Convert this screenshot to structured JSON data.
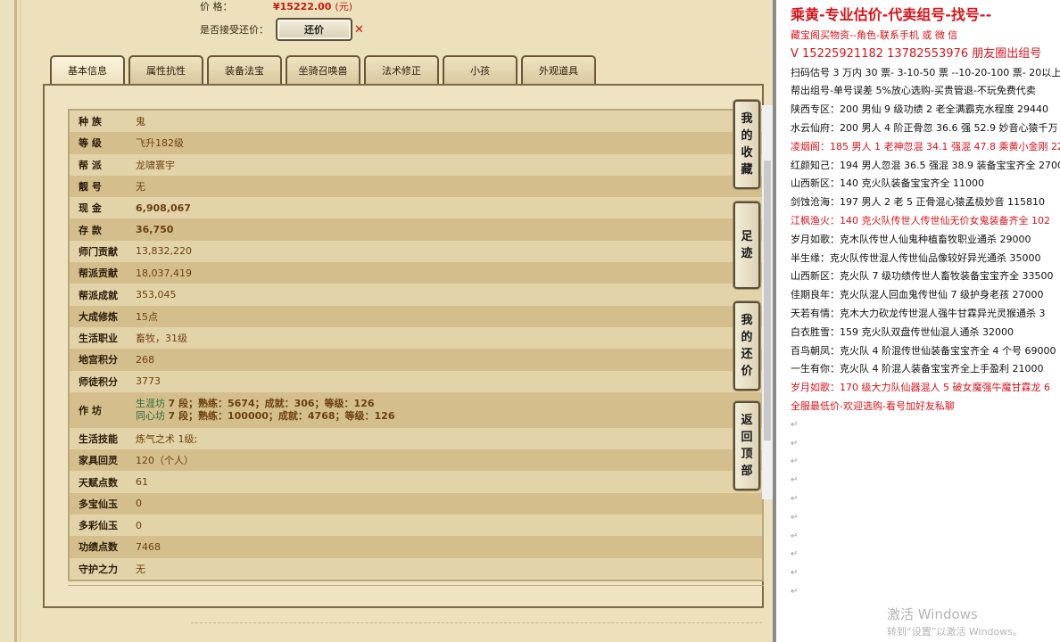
{
  "top": {
    "price_label": "价      格：",
    "price_value": "¥15222.00",
    "price_unit": "(元)",
    "bargain_label": "是否接受还价：",
    "bargain_button": "还价"
  },
  "tabs": [
    "基本信息",
    "属性抗性",
    "装备法宝",
    "坐骑召唤兽",
    "法术修正",
    "小孩",
    "外观道具"
  ],
  "info_rows": [
    {
      "k": "种    族",
      "v": "鬼",
      "style": "green"
    },
    {
      "k": "等    级",
      "v": "飞升182级",
      "style": "green"
    },
    {
      "k": "帮    派",
      "v": "龙啸寰宇",
      "style": "green"
    },
    {
      "k": "靓    号",
      "v": "无",
      "style": "gold"
    },
    {
      "k": "现    金",
      "v": "6,908,067",
      "style": "yellow"
    },
    {
      "k": "存    款",
      "v": "36,750",
      "style": "brightgreen"
    },
    {
      "k": "师门贡献",
      "v": "13,832,220",
      "style": "gold"
    },
    {
      "k": "帮派贡献",
      "v": "18,037,419",
      "style": "gold"
    },
    {
      "k": "帮派成就",
      "v": "353,045",
      "style": "gold"
    },
    {
      "k": "大成修炼",
      "v": "15点",
      "style": "gold"
    },
    {
      "k": "生活职业",
      "v": "畜牧，31级",
      "style": "gold"
    },
    {
      "k": "地宫积分",
      "v": "268",
      "style": "gold"
    },
    {
      "k": "师徒积分",
      "v": "3773",
      "style": "gold"
    }
  ],
  "workshop": {
    "label": "作    坊",
    "line1_prefix": "生涯坊",
    "line1": "7 段；熟练：5674；成就：306；等级：126",
    "line2_prefix": "同心坊",
    "line2": "7 段；熟练：100000；成就：4768；等级：126"
  },
  "info_rows2": [
    {
      "k": "生活技能",
      "v": "炼气之术 1级;",
      "style": "gold"
    },
    {
      "k": "家具回灵",
      "v": "120（个人）",
      "style": "gold"
    },
    {
      "k": "天赋点数",
      "v": "61",
      "style": "gold"
    },
    {
      "k": "多宝仙玉",
      "v": "0",
      "style": "gold"
    },
    {
      "k": "多彩仙玉",
      "v": "0",
      "style": "gold"
    },
    {
      "k": "功绩点数",
      "v": "7468",
      "style": "gold"
    },
    {
      "k": "守护之力",
      "v": "无",
      "style": "green"
    }
  ],
  "side_buttons": [
    {
      "name": "my-favorites",
      "chars": [
        "我",
        "的",
        "收",
        "藏"
      ]
    },
    {
      "name": "footprints",
      "chars": [
        "足",
        "迹"
      ]
    },
    {
      "name": "my-bargains",
      "chars": [
        "我",
        "的",
        "还",
        "价"
      ]
    },
    {
      "name": "back-to-top",
      "chars": [
        "返",
        "回",
        "顶",
        "部"
      ]
    }
  ],
  "right": {
    "title": "乘黄-专业估价-代卖组号-找号--",
    "lines": [
      {
        "t": "藏宝阁买物资--角色-联系手机 或 微 信",
        "c": "red"
      },
      {
        "t": "V 15225921182    13782553976 朋友圈出组号",
        "c": "phone"
      },
      {
        "t": "扫码估号 3 万内 30 票- 3-10-50 票  --10-20-100 票- 20以上 150",
        "c": ""
      },
      {
        "t": "帮出组号-单号误差 5%放心选购-买贵管退-不玩免费代卖",
        "c": ""
      },
      {
        "t": "陕西专区：200 男仙 9 级功绩 2 老全满霸克水程度 29440",
        "c": ""
      },
      {
        "t": "水云仙府：200 男人 4 阶正骨忽 36.6 强 52.9 妙音心猿千万",
        "c": ""
      },
      {
        "t": "凌烟阁：185 男人 1 老神忽混 34.1 强混 47.8 乘黄小金刚 22",
        "c": "red"
      },
      {
        "t": "红颜知己：194 男人忽混 36.5 强混 38.9 装备宝宝齐全 2700",
        "c": ""
      },
      {
        "t": "山西新区：140 克火队装备宝宝齐全 11000",
        "c": ""
      },
      {
        "t": "剑蚀沧海：197 男人 2 老 5 正骨混心猿孟极妙音 115810",
        "c": ""
      },
      {
        "t": "江枫渔火：140 克火队传世人传世仙无价女鬼装备齐全 102",
        "c": "red"
      },
      {
        "t": "岁月如歌：克木队传世人仙鬼种植畜牧职业通杀 29000",
        "c": ""
      },
      {
        "t": "半生缘：克火队传世混人传世仙品像较好异光通杀 35000",
        "c": ""
      },
      {
        "t": "山西新区：克火队 7 级功绩传世人畜牧装备宝宝齐全 33500",
        "c": ""
      },
      {
        "t": "佳期良年：克火队混人回血鬼传世仙 7 级护身老孩 27000",
        "c": ""
      },
      {
        "t": "天若有情：克木大力砍龙传世混人强牛甘霖异光灵猴通杀 3",
        "c": ""
      },
      {
        "t": "白衣胜雪：159 克火队双盘传世仙混人通杀 32000",
        "c": ""
      },
      {
        "t": "百鸟朝凤：克火队 4 阶混传世仙装备宝宝齐全 4 个号 69000",
        "c": ""
      },
      {
        "t": "一生有你：克火队 4 阶混人装备宝宝齐全上手盈利 21000",
        "c": ""
      },
      {
        "t": "岁月如歌：170 级大力队仙器混人 5 破女魔强牛魔甘霖龙 6",
        "c": "red"
      },
      {
        "t": "全服最低价-欢迎选购-看号加好友私聊",
        "c": "red"
      }
    ],
    "watermark1": "激活 Windows",
    "watermark2": "转到“设置”以激活 Windows。"
  }
}
